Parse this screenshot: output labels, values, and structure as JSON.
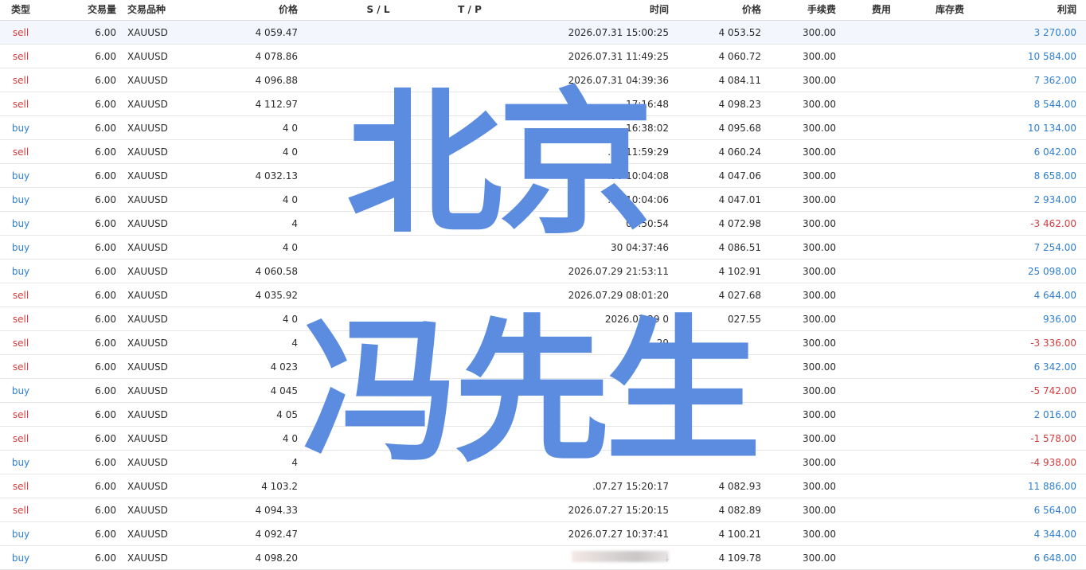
{
  "headers": {
    "type": "类型",
    "volume": "交易量",
    "symbol": "交易品种",
    "price": "价格",
    "sl": "S / L",
    "tp": "T / P",
    "time": "时间",
    "price2": "价格",
    "fee": "手续费",
    "cost": "费用",
    "stock": "库存费",
    "profit": "利润"
  },
  "rows": [
    {
      "type": "sell",
      "volume": "6.00",
      "symbol": "XAUUSD",
      "price": "4 059.47",
      "time": "2026.07.31 15:00:25",
      "price2": "4 053.52",
      "fee": "300.00",
      "profit": "3 270.00",
      "profit_sign": "pos"
    },
    {
      "type": "sell",
      "volume": "6.00",
      "symbol": "XAUUSD",
      "price": "4 078.86",
      "time": "2026.07.31 11:49:25",
      "price2": "4 060.72",
      "fee": "300.00",
      "profit": "10 584.00",
      "profit_sign": "pos"
    },
    {
      "type": "sell",
      "volume": "6.00",
      "symbol": "XAUUSD",
      "price": "4 096.88",
      "time": "2026.07.31 04:39:36",
      "price2": "4 084.11",
      "fee": "300.00",
      "profit": "7 362.00",
      "profit_sign": "pos"
    },
    {
      "type": "sell",
      "volume": "6.00",
      "symbol": "XAUUSD",
      "price": "4 112.97",
      "time": "17:16:48",
      "price2": "4 098.23",
      "fee": "300.00",
      "profit": "8 544.00",
      "profit_sign": "pos"
    },
    {
      "type": "buy",
      "volume": "6.00",
      "symbol": "XAUUSD",
      "price": "4 0",
      "time": "16:38:02",
      "price2": "4 095.68",
      "fee": "300.00",
      "profit": "10 134.00",
      "profit_sign": "pos"
    },
    {
      "type": "sell",
      "volume": "6.00",
      "symbol": "XAUUSD",
      "price": "4 0",
      "time": ".30 11:59:29",
      "price2": "4 060.24",
      "fee": "300.00",
      "profit": "6 042.00",
      "profit_sign": "pos"
    },
    {
      "type": "buy",
      "volume": "6.00",
      "symbol": "XAUUSD",
      "price": "4 032.13",
      "time": ".30 10:04:08",
      "price2": "4 047.06",
      "fee": "300.00",
      "profit": "8 658.00",
      "profit_sign": "pos"
    },
    {
      "type": "buy",
      "volume": "6.00",
      "symbol": "XAUUSD",
      "price": "4 0",
      "time": ".30 10:04:06",
      "price2": "4 047.01",
      "fee": "300.00",
      "profit": "2 934.00",
      "profit_sign": "pos"
    },
    {
      "type": "buy",
      "volume": "6.00",
      "symbol": "XAUUSD",
      "price": "4",
      "time": "05:50:54",
      "price2": "4 072.98",
      "fee": "300.00",
      "profit": "-3 462.00",
      "profit_sign": "neg"
    },
    {
      "type": "buy",
      "volume": "6.00",
      "symbol": "XAUUSD",
      "price": "4 0",
      "time": "30 04:37:46",
      "price2": "4 086.51",
      "fee": "300.00",
      "profit": "7 254.00",
      "profit_sign": "pos"
    },
    {
      "type": "buy",
      "volume": "6.00",
      "symbol": "XAUUSD",
      "price": "4 060.58",
      "time": "2026.07.29 21:53:11",
      "price2": "4 102.91",
      "fee": "300.00",
      "profit": "25 098.00",
      "profit_sign": "pos"
    },
    {
      "type": "sell",
      "volume": "6.00",
      "symbol": "XAUUSD",
      "price": "4 035.92",
      "time": "2026.07.29 08:01:20",
      "price2": "4 027.68",
      "fee": "300.00",
      "profit": "4 644.00",
      "profit_sign": "pos"
    },
    {
      "type": "sell",
      "volume": "6.00",
      "symbol": "XAUUSD",
      "price": "4 0",
      "time": "2026.07.29 0",
      "price2": "027.55",
      "fee": "300.00",
      "profit": "936.00",
      "profit_sign": "pos"
    },
    {
      "type": "sell",
      "volume": "6.00",
      "symbol": "XAUUSD",
      "price": "4",
      "time": "29",
      "price2": "",
      "fee": "300.00",
      "profit": "-3 336.00",
      "profit_sign": "neg"
    },
    {
      "type": "sell",
      "volume": "6.00",
      "symbol": "XAUUSD",
      "price": "4 023",
      "time": "",
      "price2": "",
      "fee": "300.00",
      "profit": "6 342.00",
      "profit_sign": "pos"
    },
    {
      "type": "buy",
      "volume": "6.00",
      "symbol": "XAUUSD",
      "price": "4 045",
      "time": "",
      "price2": "",
      "fee": "300.00",
      "profit": "-5 742.00",
      "profit_sign": "neg"
    },
    {
      "type": "sell",
      "volume": "6.00",
      "symbol": "XAUUSD",
      "price": "4 05",
      "time": "",
      "price2": "",
      "fee": "300.00",
      "profit": "2 016.00",
      "profit_sign": "pos"
    },
    {
      "type": "sell",
      "volume": "6.00",
      "symbol": "XAUUSD",
      "price": "4 0",
      "time": "",
      "price2": "",
      "fee": "300.00",
      "profit": "-1 578.00",
      "profit_sign": "neg"
    },
    {
      "type": "buy",
      "volume": "6.00",
      "symbol": "XAUUSD",
      "price": "4",
      "time": "",
      "price2": "",
      "fee": "300.00",
      "profit": "-4 938.00",
      "profit_sign": "neg"
    },
    {
      "type": "sell",
      "volume": "6.00",
      "symbol": "XAUUSD",
      "price": "4 103.2",
      "time": ".07.27 15:20:17",
      "price2": "4 082.93",
      "fee": "300.00",
      "profit": "11 886.00",
      "profit_sign": "pos"
    },
    {
      "type": "sell",
      "volume": "6.00",
      "symbol": "XAUUSD",
      "price": "4 094.33",
      "time": "2026.07.27 15:20:15",
      "price2": "4 082.89",
      "fee": "300.00",
      "profit": "6 564.00",
      "profit_sign": "pos"
    },
    {
      "type": "buy",
      "volume": "6.00",
      "symbol": "XAUUSD",
      "price": "4 092.47",
      "time": "2026.07.27 10:37:41",
      "price2": "4 100.21",
      "fee": "300.00",
      "profit": "4 344.00",
      "profit_sign": "pos"
    },
    {
      "type": "buy",
      "volume": "6.00",
      "symbol": "XAUUSD",
      "price": "4 098.20",
      "time": "4",
      "price2": "4 109.78",
      "fee": "300.00",
      "profit": "6 648.00",
      "profit_sign": "pos"
    }
  ],
  "colors": {
    "sell": "#d23c3c",
    "buy": "#2f7fd1",
    "watermark": "#5b8ce0"
  },
  "watermark": {
    "line1": "北京",
    "line2": "冯先生"
  }
}
